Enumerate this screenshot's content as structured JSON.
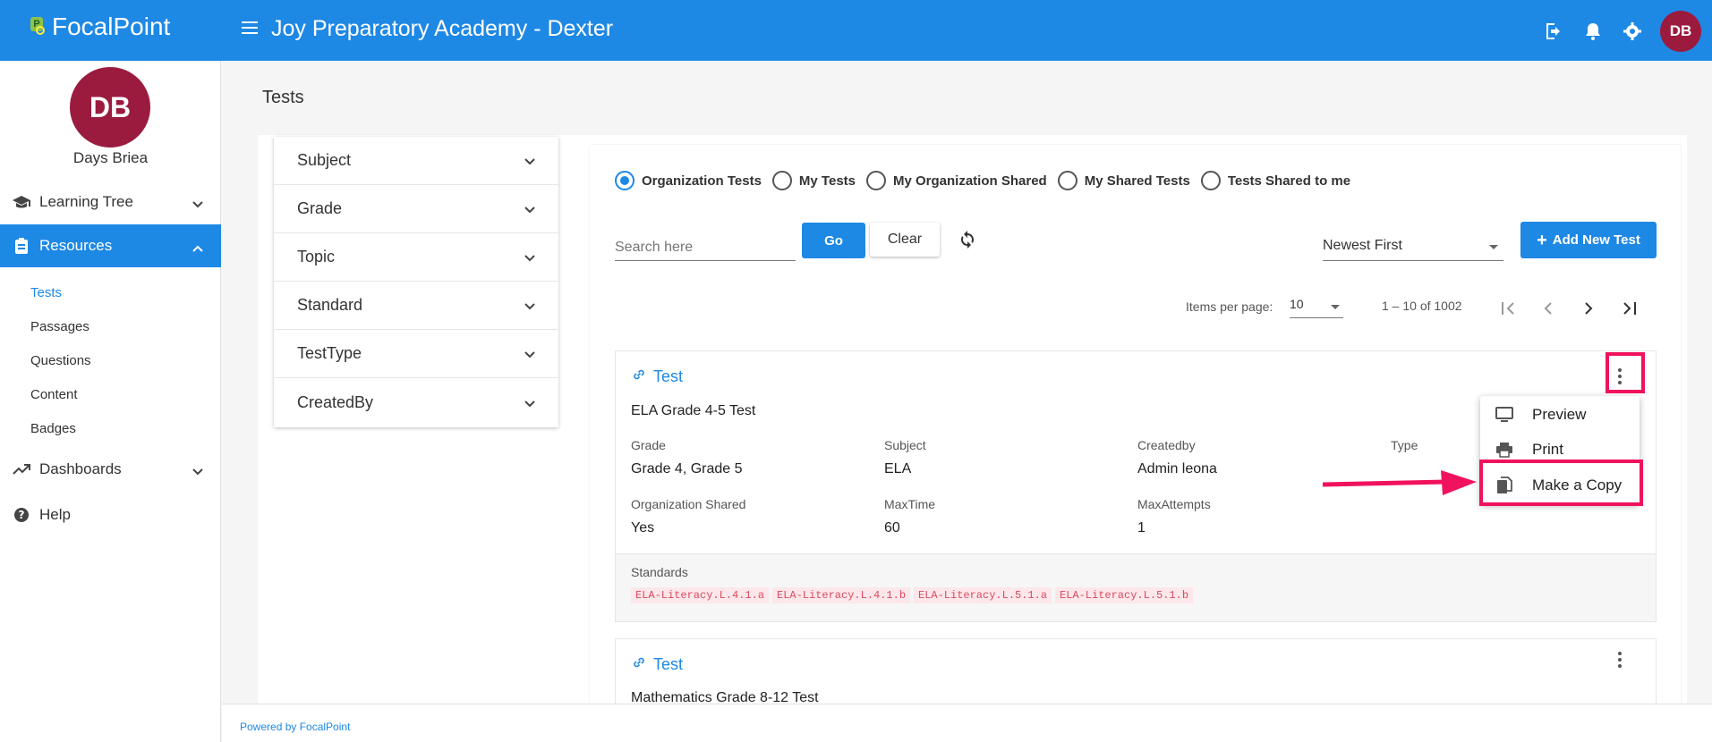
{
  "app": {
    "logo_text": "FocalPoint",
    "org_title": "Joy Preparatory Academy - Dexter",
    "user_initials": "DB"
  },
  "sidebar": {
    "avatar_initials": "DB",
    "user_name": "Days Briea",
    "items": [
      {
        "label": "Learning Tree",
        "icon": "graduation-cap-icon"
      },
      {
        "label": "Resources",
        "icon": "clipboard-icon"
      },
      {
        "label": "Dashboards",
        "icon": "trending-up-icon"
      },
      {
        "label": "Help",
        "icon": "help-icon"
      }
    ],
    "sub_items": [
      "Tests",
      "Passages",
      "Questions",
      "Content",
      "Badges"
    ]
  },
  "page": {
    "title": "Tests"
  },
  "filters": [
    "Subject",
    "Grade",
    "Topic",
    "Standard",
    "TestType",
    "CreatedBy"
  ],
  "radios": [
    {
      "label": "Organization Tests",
      "checked": true
    },
    {
      "label": "My Tests",
      "checked": false
    },
    {
      "label": "My Organization Shared",
      "checked": false
    },
    {
      "label": "My Shared Tests",
      "checked": false
    },
    {
      "label": "Tests Shared to me",
      "checked": false
    }
  ],
  "toolbar": {
    "search_placeholder": "Search here",
    "go_label": "Go",
    "clear_label": "Clear",
    "sort_value": "Newest First",
    "add_label": "Add New Test"
  },
  "pager": {
    "items_per_page_label": "Items per page:",
    "items_per_page_value": "10",
    "range": "1 – 10 of 1002"
  },
  "tests": [
    {
      "type_label": "Test",
      "name": "ELA Grade 4-5 Test",
      "fields": {
        "grade_label": "Grade",
        "grade": "Grade 4, Grade 5",
        "subject_label": "Subject",
        "subject": "ELA",
        "createdby_label": "Createdby",
        "createdby": "Admin leona",
        "type_label": "Type",
        "org_shared_label": "Organization Shared",
        "org_shared": "Yes",
        "maxtime_label": "MaxTime",
        "maxtime": "60",
        "maxattempts_label": "MaxAttempts",
        "maxattempts": "1"
      },
      "standards_label": "Standards",
      "standards": [
        "ELA-Literacy.L.4.1.a",
        "ELA-Literacy.L.4.1.b",
        "ELA-Literacy.L.5.1.a",
        "ELA-Literacy.L.5.1.b"
      ]
    },
    {
      "type_label": "Test",
      "name": "Mathematics Grade 8-12 Test"
    }
  ],
  "menu": {
    "items": [
      {
        "label": "Preview",
        "icon": "monitor-icon"
      },
      {
        "label": "Print",
        "icon": "printer-icon"
      },
      {
        "label": "Make a Copy",
        "icon": "copy-icon"
      }
    ]
  },
  "footer": {
    "text": "Powered by FocalPoint"
  },
  "colors": {
    "primary": "#1e88e5",
    "avatar": "#9b1b3f",
    "highlight": "#f0125e",
    "chip_text": "#d94a5f"
  }
}
